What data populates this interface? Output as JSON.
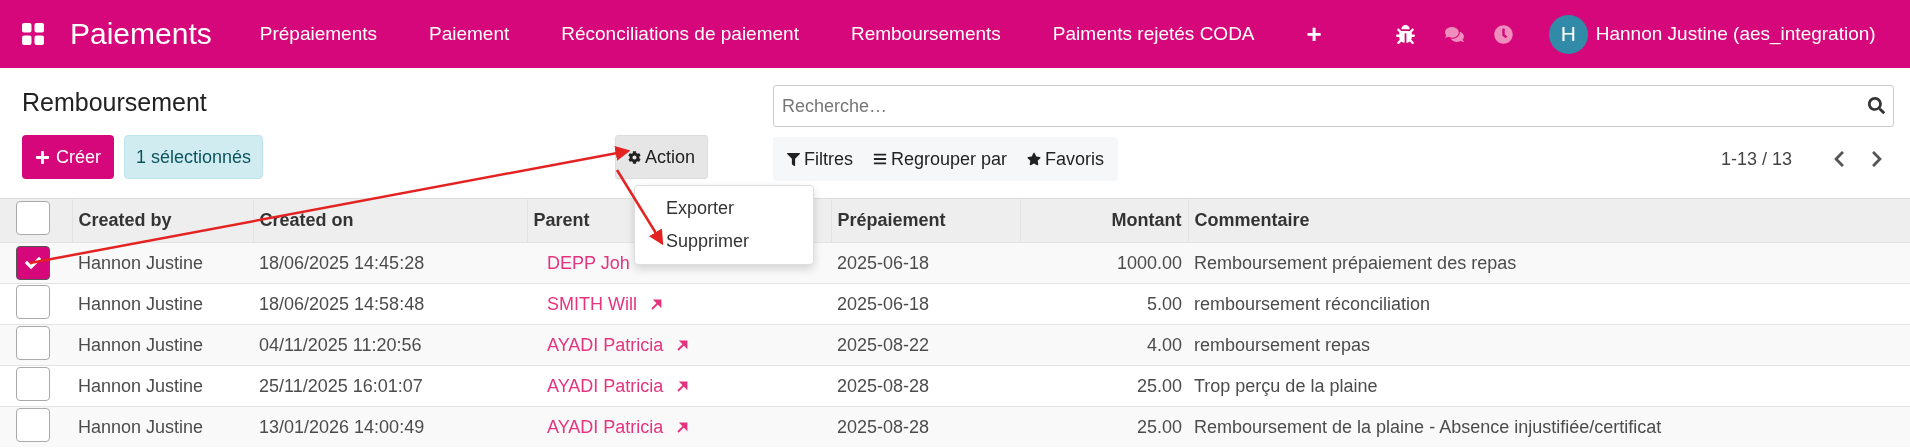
{
  "navbar": {
    "app_title": "Paiements",
    "menu": [
      "Prépaiements",
      "Paiement",
      "Réconciliations de paiement",
      "Remboursements",
      "Paiments rejetés CODA"
    ],
    "add": "+",
    "avatar": "H",
    "user": "Hannon Justine (aes_integration)"
  },
  "page_title": "Remboursement",
  "create_button": "Créer",
  "selection_badge": "1 sélectionnés",
  "action_button": "Action",
  "action_menu": {
    "open": true,
    "items": [
      "Exporter",
      "Supprimer"
    ]
  },
  "search": {
    "placeholder": "Recherche…"
  },
  "filters": [
    "Filtres",
    "Regrouper par",
    "Favoris"
  ],
  "pager": "1-13 / 13",
  "table": {
    "all_checked": false,
    "columns": [
      "Created by",
      "Created on",
      "Parent",
      "Prépaiement",
      "Montant",
      "Commentaire"
    ],
    "rows": [
      {
        "checked": true,
        "created_by": "Hannon Justine",
        "created_on": "18/06/2025 14:45:28",
        "parent": "DEPP Joh",
        "link_shown": false,
        "prepaiement": "2025-06-18",
        "montant": "1000.00",
        "commentaire": "Remboursement prépaiement des repas"
      },
      {
        "checked": false,
        "created_by": "Hannon Justine",
        "created_on": "18/06/2025 14:58:48",
        "parent": "SMITH Will",
        "link_shown": true,
        "prepaiement": "2025-06-18",
        "montant": "5.00",
        "commentaire": "remboursement réconciliation"
      },
      {
        "checked": false,
        "created_by": "Hannon Justine",
        "created_on": "04/11/2025 11:20:56",
        "parent": "AYADI Patricia",
        "link_shown": true,
        "prepaiement": "2025-08-22",
        "montant": "4.00",
        "commentaire": "remboursement repas"
      },
      {
        "checked": false,
        "created_by": "Hannon Justine",
        "created_on": "25/11/2025 16:01:07",
        "parent": "AYADI Patricia",
        "link_shown": true,
        "prepaiement": "2025-08-28",
        "montant": "25.00",
        "commentaire": "Trop perçu de la plaine"
      },
      {
        "checked": false,
        "created_by": "Hannon Justine",
        "created_on": "13/01/2026 14:00:49",
        "parent": "AYADI Patricia",
        "link_shown": true,
        "prepaiement": "2025-08-28",
        "montant": "25.00",
        "commentaire": "Remboursement de la plaine - Absence injustifiée/certificat"
      }
    ]
  }
}
